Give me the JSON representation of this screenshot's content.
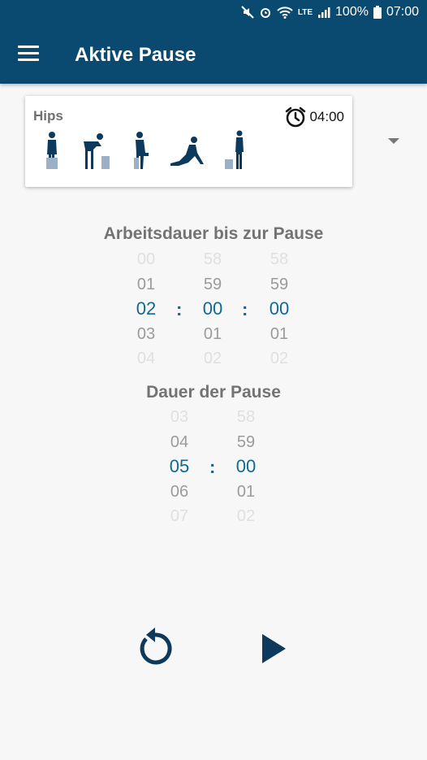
{
  "status": {
    "battery": "100%",
    "time": "07:00",
    "network": "LTE"
  },
  "header": {
    "title": "Aktive Pause"
  },
  "card": {
    "title": "Hips",
    "duration": "04:00"
  },
  "work": {
    "label": "Arbeitsdauer bis zur Pause",
    "hours": [
      "00",
      "01",
      "02",
      "03",
      "04"
    ],
    "minutes": [
      "58",
      "59",
      "00",
      "01",
      "02"
    ],
    "seconds": [
      "58",
      "59",
      "00",
      "01",
      "02"
    ]
  },
  "break": {
    "label": "Dauer der Pause",
    "minutes": [
      "03",
      "04",
      "05",
      "06",
      "07"
    ],
    "seconds": [
      "58",
      "59",
      "00",
      "01",
      "02"
    ]
  },
  "colors": {
    "appbar": "#0a4a70",
    "accent": "#0c6a94",
    "icon": "#0d3a5c"
  },
  "icons": [
    "hamburger-icon",
    "alarm-icon",
    "dropdown-arrow-icon",
    "reset-icon",
    "play-icon"
  ]
}
